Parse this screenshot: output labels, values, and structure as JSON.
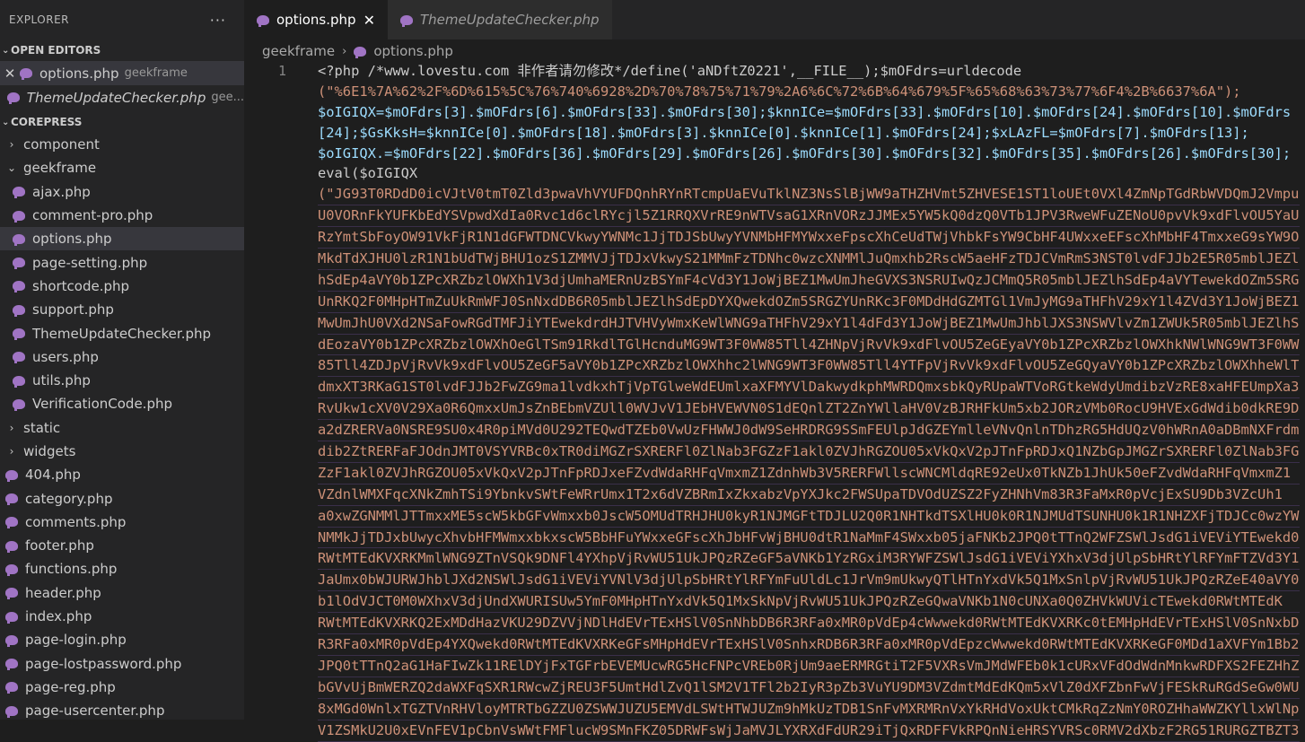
{
  "explorer": {
    "title": "EXPLORER",
    "more": "···",
    "open_editors_label": "OPEN EDITORS",
    "open_editors": [
      {
        "name": "options.php",
        "desc": "geekframe"
      },
      {
        "name": "ThemeUpdateChecker.php",
        "desc": "gee..."
      }
    ],
    "project_label": "COREPRESS",
    "tree": {
      "component": "component",
      "geekframe": "geekframe",
      "geekframe_files": [
        "ajax.php",
        "comment-pro.php",
        "options.php",
        "page-setting.php",
        "shortcode.php",
        "support.php",
        "ThemeUpdateChecker.php",
        "users.php",
        "utils.php",
        "VerificationCode.php"
      ],
      "static": "static",
      "widgets": "widgets",
      "root_files": [
        "404.php",
        "category.php",
        "comments.php",
        "footer.php",
        "functions.php",
        "header.php",
        "index.php",
        "page-login.php",
        "page-lostpassword.php",
        "page-reg.php",
        "page-usercenter.php"
      ]
    }
  },
  "tabs": [
    {
      "label": "options.php",
      "close": "✕"
    },
    {
      "label": "ThemeUpdateChecker.php"
    }
  ],
  "breadcrumb": {
    "folder": "geekframe",
    "sep": "›",
    "file": "options.php"
  },
  "editor": {
    "line_number": "1",
    "line1": "<?php /*www.lovestu.com 非作者请勿修改*/define('aNDftZ0221',__FILE__);$mOFdrs=urldecode",
    "line2": "(\"%6E1%7A%62%2F%6D%615%5C%76%740%6928%2D%70%78%75%71%79%2A6%6C%72%6B%64%679%5F%65%68%63%73%77%6F4%2B%6637%6A\");",
    "line3": "$oIGIQX=$mOFdrs[3].$mOFdrs[6].$mOFdrs[33].$mOFdrs[30];$knnICe=$mOFdrs[33].$mOFdrs[10].$mOFdrs[24].$mOFdrs[10].$mOFdrs",
    "line4": "[24];$GsKksH=$knnICe[0].$mOFdrs[18].$mOFdrs[3].$knnICe[0].$knnICe[1].$mOFdrs[24];$xLAzFL=$mOFdrs[7].$mOFdrs[13];",
    "line5": "$oIGIQX.=$mOFdrs[22].$mOFdrs[36].$mOFdrs[29].$mOFdrs[26].$mOFdrs[30].$mOFdrs[32].$mOFdrs[35].$mOFdrs[26].$mOFdrs[30];",
    "line6": "eval($oIGIQX",
    "encoded": [
      "(\"JG93T0RDdD0icVJtV0tmT0Zld3pwaVhVYUFDQnhRYnRTcmpUaEVuTklNZ3NsSlBjWW9aTHZHVmt5ZHVESE1ST1loUEt0VXl4ZmNpTGdRbWVDQmJ2Vmpu",
      "U0VORnFkYUFKbEdYSVpwdXdIa0Rvc1d6clRYcjl5Z1RRQXVrRE9nWTVsaG1XRnVORzJJMEx5YW5kQ0dzQ0VTb1JPV3RweWFuZENoU0pvVk9xdFlvOU5YaU",
      "RzYmtSbFoyOW91VkFjR1N1dGFWTDNCVkwyYWNMc1JjTDJSbUwyYVNMbHFMYWxxeFpscXhCeUdTWjVhbkFsYW9CbHF4UWxxeEFscXhMbHF4TmxxeG9sYW9O",
      "MkdTdXJHU0lzR1N1bUdTWjBHU1ozS1ZMMVJjTDJxVkwyS21MMmFzTDNhc0wzcXNMMlJuQmxhb2RscW5aeHFzTDJCVmRmS3NST0lvdFJJb2E5R05mblJEZl",
      "hSdEp4aVY0b1ZPcXRZbzlOWXh1V3djUmhaMERnUzBSYmF4cVd3Y1JoWjBEZ1MwUmJheGVXS3NSRUIwQzJCMmQ5R05mblJEZlhSdEp4aVYTewekdOZm5SRGZY",
      "UnRKQ2F0MHpHTmZuUkRmWFJ0SnNxdDB6R05mblJEZlhSdEpDYXQwekdOZm5SRGZYUnRKc3F0MDdHdGZMTGl1VmJyMG9aTHFhV29xY1l4ZVd3Y1JoWjBEZ1",
      "MwUmJhU0VXd2NSaFowRGdTMFJiYTEwekdrdHJTVHVyWmxKeWlWNG9aTHFhV29xY1l4dFd3Y1JoWjBEZ1MwUmJhblJXS3NSWVlvZm1ZWUk5R05mblJEZlhS",
      "dEozaVY0b1ZPcXRZbzlOWXhOeGlTSm91RkdlTGlHcnduMG9WT3F0WW85Tll4ZHNpVjRvVk9xdFlvOU5ZeGEyaVY0b1ZPcXRZbzlOWXhkNWlWNG9WT3F0WW",
      "85Tll4ZDJpVjRvVk9xdFlvOU5ZeGF5aVY0b1ZPcXRZbzlOWXhhc2lWNG9WT3F0WW85Tll4YTFpVjRvVk9xdFlvOU5ZeGQyaVY0b1ZPcXRZbzlOWXhheWlT",
      "dmxXT3RKaG1ST0lvdFJJb2FwZG9ma1lvdkxhTjVpTGlweWdEUmlxaXFMYVlDakwydkphMWRDQmxsbkQyRUpaWTVoRGtkeWdyUmdibzVzRE8xaHFEUmpXa3",
      "RvUkw1cXV0V29Xa0R6QmxxUmJsZnBEbmVZUll0WVJvV1JEbHVEWVN0S1dEQnlZT2ZnYWllaHV0VzBJRHFkUm5xb2JORzVMb0RocU9HVExGdWdib0dkRE9D",
      "a2dZRERVa0NSRE9SU0x4R0piMVd0U292TEQwdTZEb0VwUzFHWWJ0dW9SeHRDRG9SSmFEUlpJdGZEYmlleVNvQnlnTDhzRG5HdUQzV0hWRnA0aDBmNXFrdm",
      "dib2ZtRERFaFJOdnJMT0VSYVRBc0xTR0diMGZrSXRERFl0ZlNab3FGZzF1akl0ZVJhRGZOU05xVkQxV2pJTnFpRDJxQ1NZbGpJMGZrSXRERFl0ZlNab3FG",
      "ZzF1akl0ZVJhRGZOU05xVkQxV2pJTnFpRDJxeFZvdWdaRHFqVmxmZ1ZdnhWb3V5RERFWllscWNCMldqRE92eUx0TkNZb1JhUk50eFZvdWdaRHFqVmxmZ1",
      "VZdnlWMXFqcXNkZmhTSi9YbnkvSWtFeWRrUmx1T2x6dVZBRmIxZkxabzVpYXJkc2FWSUpaTDVOdUZSZ2FyZHNhVm83R3FaMxR0pVcjExSU9Db3VZcUh1",
      "a0xwZGNMMlJTTmxxME5scW5kbGFvWmxxb0JscW5OMUdTRHJHU0kyR1NJMGFtTDJLU2Q0R1NHTkdTSXlHU0k0R1NJMUdTSUNHU0k1R1NHZXFjTDJCc0wzYW",
      "NMMkJjTDJxbUwycXhvbHFMWmxxbkxscW5BbHFuYWxxeGFscXhJbHFvWjBHU0dtR1NaMmF4SWxxb05jaFNKb2JPQ0tTTnQ2WFZSWlJsdG1iVEViYTEwekd0",
      "RWtMTEdKVXRKMmlWNG9ZTnVSQk9DNFl4YXhpVjRvWU51UkJPQzRZeGF5aVNKb1YzRGxiM3RYWFZSWlJsdG1iVEViYXhxV3djUlpSbHRtYlRFYmFTZVd3Y1",
      "JaUmx0bWJURWJhblJXd2NSWlJsdG1iVEViYVNlV3djUlpSbHRtYlRFYmFuUldLc1JrVm9mUkwyQTlHTnYxdVk5Q1MxSnlpVjRvWU51UkJPQzRZeE40aVY0",
      "b1lOdVJCT0M0WXhxV3djUndXWURISUw5YmF0MHpHTnYxdVk5Q1MxSkNpVjRvWU51UkJPQzRZeGQwaVNKb1N0cUNXa0Q0ZHVkWUVicTEwekd0RWtMTEdK",
      "RWtMTEdKVXRKQ2ExMDdHazVKU29DZVVjNDlHdEVrTExHSlV0SnNhbDB6R3RFa0xMR0pVdEp4cWwwekd0RWtMTEdKVXRKc0tEMHpHdEVrTExHSlV0SnNxbDB6",
      "R3RFa0xMR0pVdEp4YXQwekd0RWtMTEdKVXRKeGFsMHpHdEVrTExHSlV0SnhxRDB6R3RFa0xMR0pVdEpzcWwwekd0RWtMTEdKVXRKeGF0MDd1aXVFYm1Bb2",
      "JPQ0tTTnQ2aG1HaFIwZk11RElDYjFxTGFrbEVEMUcwRG5HcFNPcVREb0RjUm9aeERMRGtiT2F5VXRsVmJMdWFEb0k1cURxVFdOdWdnMnkwRDFXS2FEZHhZ",
      "bGVvUjBmWERZQ2daWXFqSXR1RWcwZjREU3F5UmtHdlZvQ1lSM2V1TFl2b2IyR3pZb3VuYU9DM3VZdmtMdEdKQm5xVlZ0dXFZbnFwVjFESkRuRGdSeGw0WU",
      "8xMGd0WnlxTGZTVnRHVloyMTRTbGZZU0ZSWWJUZU5EMVdLSWtHTWJUZm9hMkUzTDB1SnFvMXRMRnVxYkRHdVoxUktCMkRqZzNmY0ROZHhaWWZKYllxWlNp",
      "V1ZSMkU2U0xEVnFEV1pCbnVsWWtFMFlucW9SMnFKZ05DRWFsWjJaMVJLYXRXdFdUR29iTjQxRDFFVkRPQnNieHRSYVRSc0RMV2dXbzF2RG51RURGZTBZT3"
    ]
  }
}
